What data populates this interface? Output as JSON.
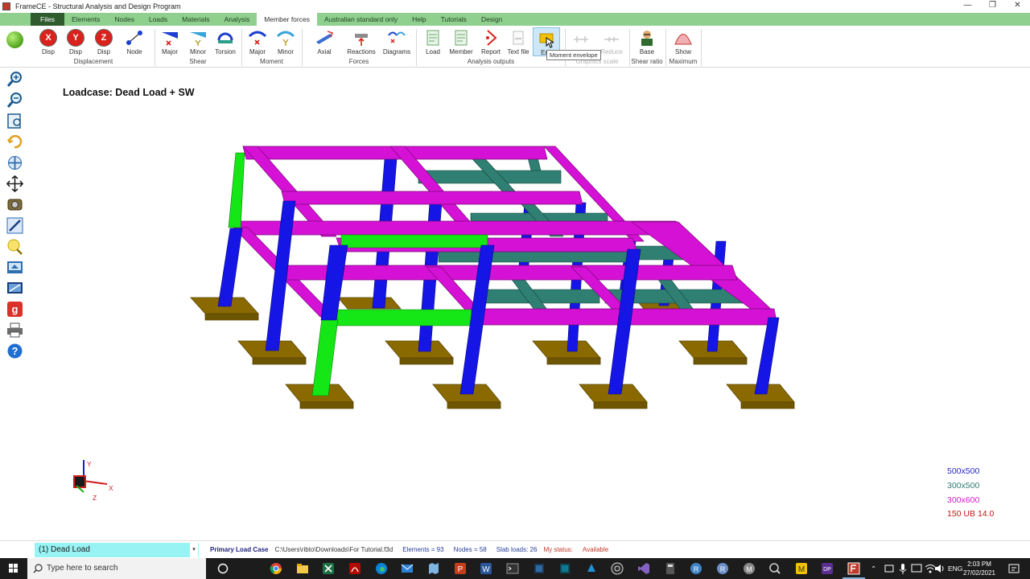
{
  "window": {
    "title": "FrameCE - Structural Analysis and Design Program",
    "controls": [
      "—",
      "❐",
      "✕"
    ]
  },
  "menu": {
    "tabs": [
      "Files",
      "Elements",
      "Nodes",
      "Loads",
      "Materials",
      "Analysis",
      "Member forces",
      "Australian standard only",
      "Help",
      "Tutorials",
      "Design"
    ],
    "active_index": 6
  },
  "ribbon": {
    "buttons": [
      {
        "label": "Disp",
        "icon": "x-disp-icon"
      },
      {
        "label": "Disp",
        "icon": "y-disp-icon"
      },
      {
        "label": "Disp",
        "icon": "z-disp-icon"
      },
      {
        "label": "Node",
        "icon": "node-icon"
      },
      {
        "label": "Major",
        "icon": "shear-major-icon"
      },
      {
        "label": "Minor",
        "icon": "shear-minor-icon"
      },
      {
        "label": "Torsion",
        "icon": "torsion-icon"
      },
      {
        "label": "Major",
        "icon": "moment-major-icon"
      },
      {
        "label": "Minor",
        "icon": "moment-minor-icon"
      },
      {
        "label": "Axial",
        "icon": "axial-icon"
      },
      {
        "label": "Reactions",
        "icon": "reactions-icon"
      },
      {
        "label": "Diagrams",
        "icon": "diagrams-icon"
      },
      {
        "label": "Load",
        "icon": "load-output-icon"
      },
      {
        "label": "Member",
        "icon": "member-output-icon"
      },
      {
        "label": "Report",
        "icon": "report-icon"
      },
      {
        "label": "Text file",
        "icon": "text-file-icon"
      },
      {
        "label": "Env",
        "icon": "envelope-icon"
      },
      {
        "label": "",
        "icon": "enlarge-icon"
      },
      {
        "label": "Reduce",
        "icon": "reduce-icon"
      },
      {
        "label": "Base",
        "icon": "base-icon"
      },
      {
        "label": "Show",
        "icon": "show-icon"
      }
    ],
    "groups": [
      "Displacement",
      "Shear",
      "Moment",
      "Forces",
      "Analysis outputs",
      "Graphics scale",
      "Shear ratio",
      "Maximum"
    ],
    "tooltip": "Moment envelope",
    "letters": {
      "x": "X",
      "y": "Y",
      "z": "Z"
    },
    "colors": {
      "disp": "#d9221c",
      "shear": "#1c3fd1",
      "moment": "#1c3fd1",
      "accent": "#8fd08f"
    }
  },
  "canvas": {
    "loadcase_title": "Loadcase: Dead Load + SW",
    "axes": {
      "x": "X",
      "y": "Y",
      "z": "Z"
    },
    "legend": [
      {
        "text": "500x500",
        "color": "#2626c8"
      },
      {
        "text": "300x500",
        "color": "#2f7b74"
      },
      {
        "text": "300x600",
        "color": "#d11ad1"
      },
      {
        "text": "150 UB 14.0",
        "color": "#c01616"
      }
    ],
    "member_colors": {
      "column": "#1515e6",
      "beam_300x600": "#d511d5",
      "beam_300x500": "#2f7f73",
      "steel": "#15e615",
      "footing": "#8a6a00"
    }
  },
  "left_toolbar": [
    "zoom-in-icon",
    "zoom-out-icon",
    "zoom-window-icon",
    "rotate-icon",
    "pan-icon",
    "settings-icon",
    "draw-icon",
    "light-icon",
    "view3d-icon",
    "screen-icon",
    "google-icon",
    "print-icon",
    "help-icon"
  ],
  "status": {
    "loadcase_select": "(1) Dead Load",
    "primary": "Primary Load Case",
    "path": "C:\\Users\\ribto\\Downloads\\For Tutorial.f3d",
    "elements": "Elements = 93",
    "nodes": "Nodes = 58",
    "slab_loads": "Slab loads: 26",
    "my_status_label": "My status:",
    "my_status_value": "Available"
  },
  "taskbar": {
    "search_placeholder": "Type here to search",
    "apps": [
      "task-view-icon",
      "chrome-icon",
      "file-explorer-icon",
      "excel-icon",
      "acrobat-icon",
      "edge-icon",
      "mail-icon",
      "maps-icon",
      "powerpoint-icon",
      "word-icon",
      "terminal-icon",
      "app-icon",
      "teams-icon",
      "obs-icon",
      "visual-studio-icon",
      "calculator-icon",
      "r-icon",
      "pdf-icon",
      "search-app-icon",
      "m-icon",
      "gimp-icon",
      "frame-icon"
    ],
    "tray_lang": "ENG",
    "time": "2:03 PM",
    "date": "27/02/2021"
  }
}
